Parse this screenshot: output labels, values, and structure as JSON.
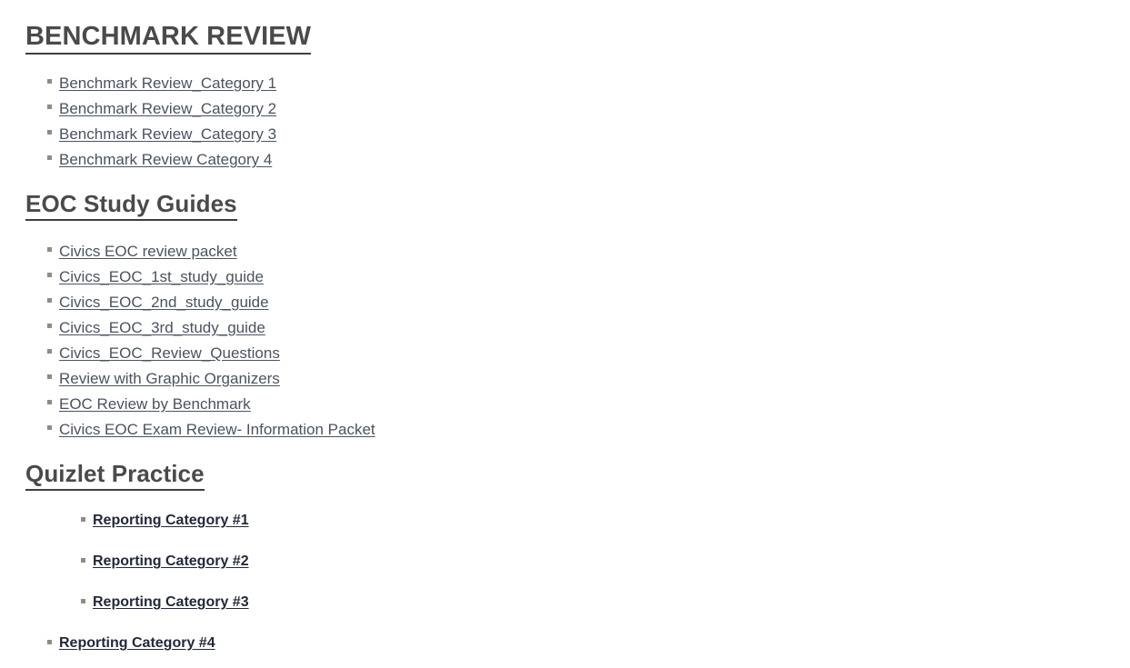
{
  "sections": [
    {
      "id": "benchmark-review",
      "heading": "BENCHMARK REVIEW",
      "items": [
        "Benchmark Review_Category 1",
        "Benchmark Review_Category 2",
        "Benchmark Review_Category 3",
        "Benchmark Review Category 4"
      ]
    },
    {
      "id": "eoc-study-guides",
      "heading": "EOC Study Guides",
      "items": [
        "Civics EOC review packet",
        "Civics_EOC_1st_study_guide",
        "Civics_EOC_2nd_study_guide",
        "Civics_EOC_3rd_study_guide",
        "Civics_EOC_Review_Questions",
        "Review with Graphic Organizers",
        "EOC Review by Benchmark",
        "Civics EOC Exam Review- Information Packet"
      ]
    },
    {
      "id": "quizlet-practice",
      "heading": "Quizlet Practice",
      "nested_items": [
        "Reporting Category #1",
        "Reporting Category #2",
        "Reporting Category #3"
      ],
      "outer_items": [
        "Reporting Category #4"
      ]
    }
  ],
  "colors": {
    "heading_text": "#4a4a4a",
    "link_text": "#4a5360",
    "emphasis_link_text": "#22293a",
    "bullet": "#8c8c8c",
    "background": "#ffffff"
  }
}
